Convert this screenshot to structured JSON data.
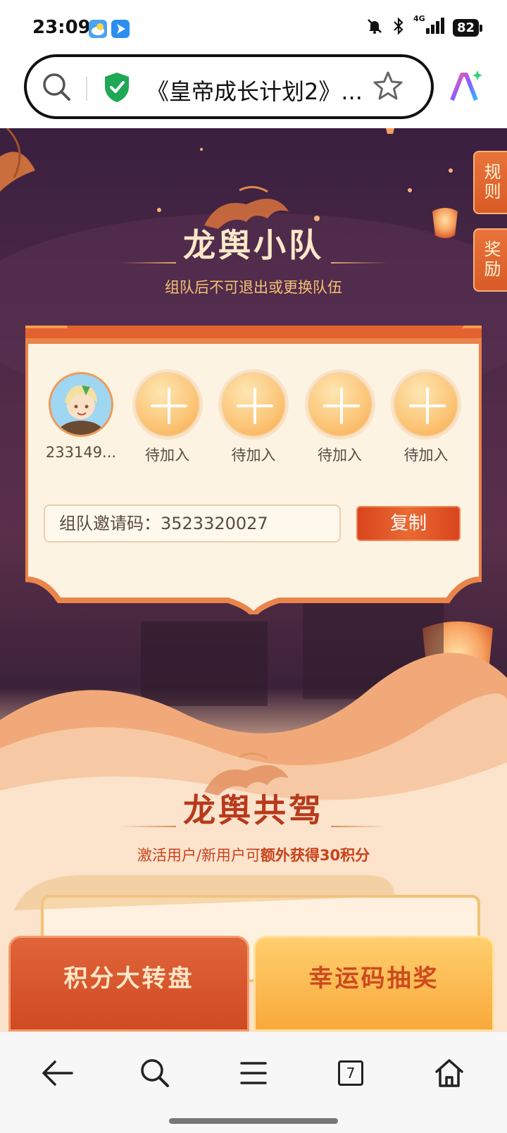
{
  "status_bar": {
    "time": "23:09",
    "battery": "82",
    "network": "4G"
  },
  "browser": {
    "page_title": "《皇帝成长计划2》...",
    "bottom_nav": {
      "tab_count": "7"
    }
  },
  "side_tabs": {
    "rules": "规则",
    "rewards": "奖励"
  },
  "team": {
    "title": "龙舆小队",
    "subtitle": "组队后不可退出或更换队伍",
    "members": [
      {
        "name": "233149..."
      },
      {
        "name": "待加入"
      },
      {
        "name": "待加入"
      },
      {
        "name": "待加入"
      },
      {
        "name": "待加入"
      }
    ],
    "invite_label": "组队邀请码：",
    "invite_code": "3523320027",
    "copy_label": "复制"
  },
  "ride": {
    "title": "龙舆共驾",
    "subtitle_prefix": "激活用户/新用户可",
    "subtitle_highlight": "额外获得30积分"
  },
  "tabs": {
    "left": "积分大转盘",
    "right": "幸运码抽奖"
  },
  "colors": {
    "accent": "#c8421b",
    "gold": "#f3c173",
    "card_bg": "#fdf3e3",
    "bg_dark": "#3a1f3f"
  }
}
